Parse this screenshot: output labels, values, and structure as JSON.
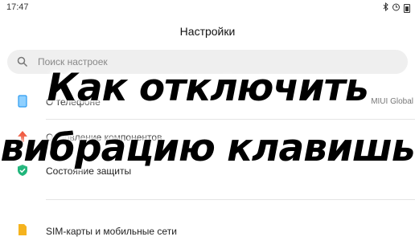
{
  "status": {
    "time": "17:47"
  },
  "header": {
    "title": "Настройки"
  },
  "search": {
    "placeholder": "Поиск настроек"
  },
  "items": [
    {
      "label": "О телефоне",
      "value": "MIUI Global",
      "icon": "tablet-icon",
      "color": "#2d9bf0"
    },
    {
      "label": "Обновление компонентов",
      "value": "",
      "icon": "update-arrow-icon",
      "color": "#f0553a"
    },
    {
      "label": "Состояние защиты",
      "value": "",
      "icon": "shield-check-icon",
      "color": "#1fb57a"
    },
    {
      "label": "SIM-карты и мобильные сети",
      "value": "",
      "icon": "sim-card-icon",
      "color": "#f5b31e"
    }
  ],
  "overlay": {
    "line1": "Как отключить",
    "line2": "вибрацию клавишь"
  }
}
